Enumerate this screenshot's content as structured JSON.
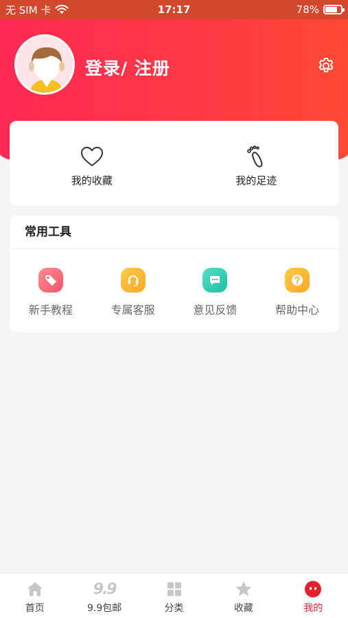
{
  "status_bar": {
    "carrier": "无 SIM 卡",
    "time": "17:17",
    "battery_percent": "78%",
    "battery_level": 0.78
  },
  "header": {
    "login_label": "登录/ 注册",
    "gear_icon": "settings-gear-icon",
    "accent_gradient": [
      "#fe2a55",
      "#fe4a33"
    ]
  },
  "quick_actions": [
    {
      "label": "我的收藏",
      "icon": "heart-icon"
    },
    {
      "label": "我的足迹",
      "icon": "footprint-icon"
    }
  ],
  "tools": {
    "title": "常用工具",
    "items": [
      {
        "label": "新手教程",
        "icon": "tag-icon",
        "color": "#fb6b78"
      },
      {
        "label": "专属客服",
        "icon": "headset-icon",
        "color": "#fdb23a"
      },
      {
        "label": "意见反馈",
        "icon": "chat-icon",
        "color": "#2fd0b4"
      },
      {
        "label": "帮助中心",
        "icon": "question-icon",
        "color": "#fdb23a"
      }
    ]
  },
  "tabbar": {
    "items": [
      {
        "label": "首页",
        "icon": "home-icon",
        "active": false
      },
      {
        "label": "9.9包邮",
        "icon": "nine-nine-icon",
        "icon_text": "9.9",
        "active": false
      },
      {
        "label": "分类",
        "icon": "grid-icon",
        "active": false
      },
      {
        "label": "收藏",
        "icon": "star-icon",
        "active": false
      },
      {
        "label": "我的",
        "icon": "profile-face-icon",
        "active": true
      }
    ],
    "active_color": "#e8202e"
  }
}
